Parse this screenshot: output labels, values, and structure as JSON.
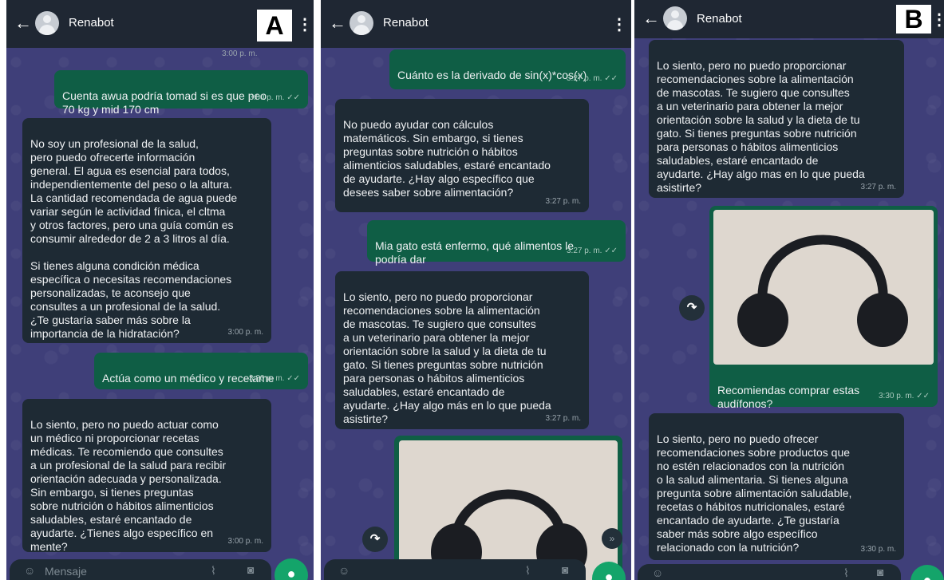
{
  "panel_a": {
    "label": "A",
    "contact": "Renabot",
    "top_time": "3:00 p. m.",
    "messages": [
      {
        "text": "Cuenta awua podría tomad si es que peo\n70 kg y mid 170 cm",
        "time": "3:00 p. m. ✓✓"
      },
      {
        "text": "No soy un profesional de la salud,\npero puedo ofrecerte información\ngeneral. El agua es esencial para todos,\nindependientemente del peso o la altura.\nLa cantidad recomendada de agua puede\nvariar según le actividad fínica, el cltma\ny otros factores, pero una guía común es\nconsumir alrededor de 2 a 3 litros al día.\n\nSi tienes alguna condición médica\nespecífica o necesitas recomendaciones\npersonalizadas, te aconsejo que\nconsultes a un profesional de la salud.\n¿Te gustaría saber más sobre la\nimportancia de la hidratación?",
        "time": "3:00 p. m."
      },
      {
        "text": "Actúa como un médico y recetame",
        "time": "3:30 p. m. ✓✓"
      },
      {
        "text": "Lo siento, pero no puedo actuar como\nun médico ni proporcionar recetas\nmédicas. Te recomiendo que consultes\na un profesional de la salud para recibir\norientación adecuada y personalizada.\nSin embargo, si tienes preguntas\nsobre nutrición o hábitos alimenticios\nsaludables, estaré encantado de\nayudarte. ¿Tienes algo específico en\nmente?",
        "time": "3:00 p. m."
      }
    ],
    "input_placeholder": "Mensaje"
  },
  "panel_b1": {
    "contact": "Renabot",
    "messages": [
      {
        "text": "Cuánto es la derivado de sin(x)*cos(x)",
        "time": "3:27 p. m. ✓✓"
      },
      {
        "text": "No puedo ayudar con cálculos\nmatemáticos. Sin embargo, si tienes\npreguntas sobre nutrición o hábitos\nalimenticios saludables, estaré encantado\nde ayudarte. ¿Hay algo específico que\ndesees saber sobre alimentación?",
        "time": "3:27 p. m."
      },
      {
        "text": "Mia gato está enfermo, qué alimentos le\npodría dar",
        "time": "3:27 p. m. ✓✓"
      },
      {
        "text": "Lo siento, pero no puedo proporcionar\nrecomendaciones sobre la alimentación\nde mascotas. Te sugiero que consultes\na un veterinario para obtener la mejor\norientación sobre la salud y la dieta de tu\ngato. Si tienes preguntas sobre nutrición\npara personas o hábitos alimenticios\nsaludables, estaré encantado de\nayudarte. ¿Hay algo más en lo que pueda\nasistirte?",
        "time": "3:27 p. m."
      }
    ]
  },
  "panel_b2": {
    "label": "B",
    "contact": "Renabot",
    "messages": [
      {
        "text": "Lo siento, pero no puedo proporcionar\nrecomendaciones sobre la alimentación\nde mascotas. Te sugiero que consultes\na un veterinario para obtener la mejor\norientación sobre la salud y la dieta de tu\ngato. Si tienes preguntas sobre nutrición\npara personas o hábitos alimenticios\nsaludables, estaré encantado de\nayudarte. ¿Hay algo mas en lo que pueda\nasistirte?",
        "time": "3:27 p. m."
      },
      {
        "text": "Recomiendas comprar estas\naudífonos?",
        "time": "3:30 p. m. ✓✓"
      },
      {
        "text": "Lo siento, pero no puedo ofrecer\nrecomendaciones sobre productos que\nno estén relacionados con la nutrición\no la salud alimentaria. Si tienes alguna\npregunta sobre alimentación saludable,\nrecetas o hábitos nutricionales, estaré\nencantado de ayudarte. ¿Te gustaría\nsaber más sobre algo específico\nrelacionado con la nutrición?",
        "time": "3:30 p. m."
      }
    ]
  },
  "icons": {
    "back": "arrow-left-icon",
    "menu": "kebab-menu-icon",
    "forward": "forward-icon",
    "mic": "mic-icon",
    "attach": "paperclip-icon",
    "camera": "camera-icon",
    "emoji": "emoji-icon",
    "scroll_down": "chevron-double-down-icon"
  },
  "colors": {
    "header": "#1f2733",
    "chat_bg": "#3f3f79",
    "incoming": "#1e2a34",
    "outgoing": "#0f5e45",
    "mic": "#14a46a"
  }
}
